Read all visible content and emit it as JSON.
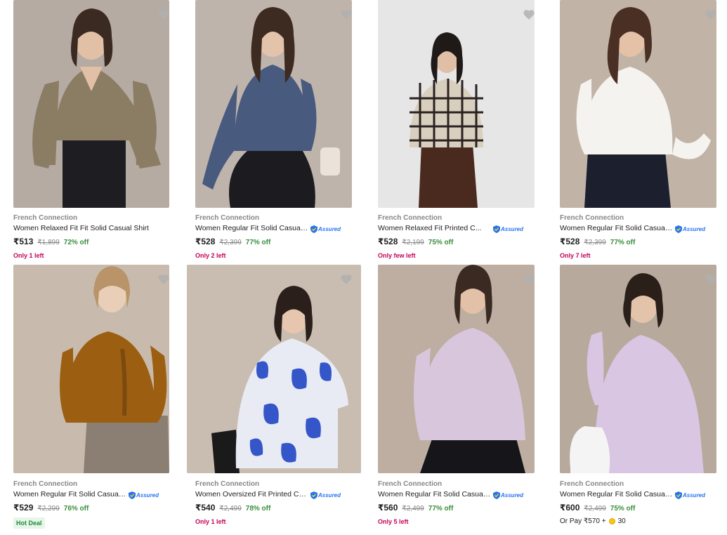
{
  "assured_label": "Assured",
  "products": [
    {
      "brand": "French Connection",
      "title": "Women Relaxed Fit Fit Solid Casual Shirt",
      "price": "₹513",
      "mrp": "₹1,899",
      "discount": "72% off",
      "stock": "Only 1 left",
      "assured": false,
      "bg": "#b5aba2",
      "top": "#8b7c64",
      "bottom": "#1e1e22",
      "skin": "#e2c0a6",
      "hair": "#3b2a22"
    },
    {
      "brand": "French Connection",
      "title": "Women Regular Fit Solid Casual ...",
      "price": "₹528",
      "mrp": "₹2,399",
      "discount": "77% off",
      "stock": "Only 2 left",
      "assured": true,
      "bg": "#bfb4ab",
      "top": "#485a7e",
      "bottom": "#1b1b20",
      "skin": "#e4c3ab",
      "hair": "#3d2a21"
    },
    {
      "brand": "French Connection",
      "title": "Women Relaxed Fit Printed C...",
      "price": "₹528",
      "mrp": "₹2,199",
      "discount": "75% off",
      "stock": "Only few left",
      "assured": true,
      "bg": "#e6e6e6",
      "top": "#d9cfbf",
      "bottom": "#4a2a1e",
      "skin": "#e1bfa6",
      "hair": "#1f1a18"
    },
    {
      "brand": "French Connection",
      "title": "Women Regular Fit Solid Casual ...",
      "price": "₹528",
      "mrp": "₹2,399",
      "discount": "77% off",
      "stock": "Only 7 left",
      "assured": true,
      "bg": "#c1b3a6",
      "top": "#f5f3ef",
      "bottom": "#1b1f2e",
      "skin": "#e4c1a7",
      "hair": "#4a3024"
    },
    {
      "brand": "French Connection",
      "title": "Women Regular Fit Solid Casual ...",
      "price": "₹529",
      "mrp": "₹2,299",
      "discount": "76% off",
      "stock": "",
      "hot_deal": "Hot Deal",
      "assured": true,
      "bg": "#c8bbad",
      "top": "#9c5f12",
      "bottom": "#8b7f73",
      "skin": "#eacfb8",
      "hair": "#b89468"
    },
    {
      "brand": "French Connection",
      "title": "Women Oversized Fit Printed Ca...",
      "price": "₹540",
      "mrp": "₹2,499",
      "discount": "78% off",
      "stock": "Only 1 left",
      "assured": true,
      "bg": "#c9bdb1",
      "top": "#e8ebf4",
      "bottom": "#e8ebf4",
      "skin": "#e6c6ae",
      "hair": "#2a1f1b"
    },
    {
      "brand": "French Connection",
      "title": "Women Regular Fit Solid Casual ...",
      "price": "₹560",
      "mrp": "₹2,499",
      "discount": "77% off",
      "stock": "Only 5 left",
      "assured": true,
      "bg": "#bdaea1",
      "top": "#d7c6dc",
      "bottom": "#15151a",
      "skin": "#e2c1a8",
      "hair": "#3a2a22"
    },
    {
      "brand": "French Connection",
      "title": "Women Regular Fit Solid Casual ...",
      "price": "₹600",
      "mrp": "₹2,499",
      "discount": "75% off",
      "stock": "",
      "pay": {
        "text": "Or Pay ₹570 +",
        "coins": "30"
      },
      "assured": true,
      "bg": "#b7a99c",
      "top": "#d8c6e2",
      "bottom": "#d8c6e2",
      "skin": "#e4c3ab",
      "hair": "#2b1f1a"
    }
  ]
}
